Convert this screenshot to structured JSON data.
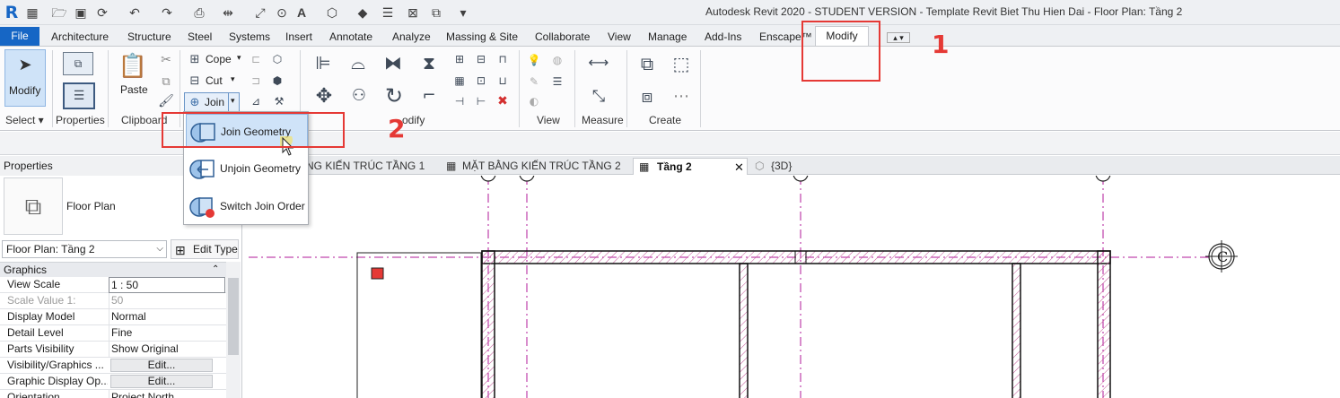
{
  "app": {
    "title": "Autodesk Revit 2020 - STUDENT VERSION - Template Revit Biet Thu Hien Dai - Floor Plan: Tầng 2",
    "logo": "R"
  },
  "quick_access": [
    "revit-logo",
    "grid-icon",
    "open-icon",
    "save-icon",
    "sync-icon",
    "undo-icon",
    "redo-icon",
    "print-icon",
    "measure-icon",
    "tag-icon",
    "text-icon",
    "3d-view-icon",
    "section-icon",
    "thin-lines-icon",
    "close-hidden-icon",
    "switch-windows-icon",
    "customize-icon"
  ],
  "ribbon_tabs": [
    "File",
    "Architecture",
    "Structure",
    "Steel",
    "Systems",
    "Insert",
    "Annotate",
    "Analyze",
    "Massing & Site",
    "Collaborate",
    "View",
    "Manage",
    "Add-Ins",
    "Enscape™",
    "Modify"
  ],
  "ribbon": {
    "modify_label": "Modify",
    "select_label": "Select ▾",
    "properties_label": "Properties",
    "paste_label": "Paste",
    "clipboard_label": "Clipboard",
    "cope_label": "Cope",
    "cut_label": "Cut",
    "join_label": "Join",
    "geometry_label_partial": "odify",
    "view_label": "View",
    "measure_label": "Measure",
    "create_label": "Create"
  },
  "join_menu": {
    "items": [
      "Join Geometry",
      "Unjoin Geometry",
      "Switch Join Order"
    ]
  },
  "properties": {
    "header": "Properties",
    "type_name": "Floor Plan",
    "selector": "Floor Plan: Tầng 2",
    "edit_type": "Edit Type",
    "graphics_header": "Graphics",
    "rows": [
      {
        "name": "View Scale",
        "value": "1 : 50"
      },
      {
        "name": "Scale Value    1:",
        "value": "50"
      },
      {
        "name": "Display Model",
        "value": "Normal"
      },
      {
        "name": "Detail Level",
        "value": "Fine"
      },
      {
        "name": "Parts Visibility",
        "value": "Show Original"
      },
      {
        "name": "Visibility/Graphics ...",
        "value": "Edit..."
      },
      {
        "name": "Graphic Display Op...",
        "value": "Edit..."
      },
      {
        "name": "Orientation",
        "value": "Project North"
      }
    ]
  },
  "view_tabs": [
    "NG KIẾN TRÚC TẦNG 1",
    "MẶT BẰNG KIẾN TRÚC TẦNG 2",
    "Tầng 2",
    "{3D}"
  ],
  "canvas": {
    "grid_bubble": "C"
  },
  "annotations": {
    "step1": "1",
    "step2": "2"
  },
  "colors": {
    "accent": "#1666c5",
    "annotation": "#e53935",
    "grid_line": "#b2189a",
    "wall_hatch": "#c45a9a"
  }
}
